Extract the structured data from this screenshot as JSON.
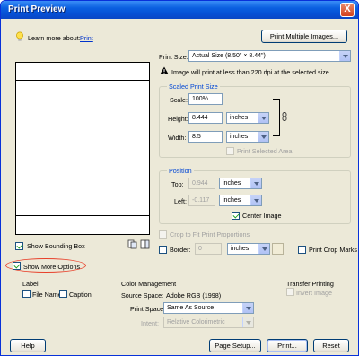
{
  "window": {
    "title": "Print Preview",
    "close_label": "X"
  },
  "learn": {
    "text": "Learn more about:",
    "link": "Print"
  },
  "buttons": {
    "print_multiple": "Print Multiple Images...",
    "help": "Help",
    "page_setup": "Page Setup...",
    "print": "Print...",
    "reset": "Reset"
  },
  "print_size": {
    "label": "Print Size:",
    "value": "Actual Size (8.50\" × 8.44\")"
  },
  "warning": "Image will print at less than 220 dpi at the selected size",
  "scaled": {
    "title": "Scaled Print Size",
    "scale_label": "Scale:",
    "scale_value": "100%",
    "height_label": "Height:",
    "height_value": "8.444",
    "height_unit": "inches",
    "width_label": "Width:",
    "width_value": "8.5",
    "width_unit": "inches",
    "print_selected": "Print Selected Area"
  },
  "position": {
    "title": "Position",
    "top_label": "Top:",
    "top_value": "0.944",
    "top_unit": "inches",
    "left_label": "Left:",
    "left_value": "-0.117",
    "left_unit": "inches",
    "center_image": "Center Image"
  },
  "crop_fit": "Crop to Fit Print Proportions",
  "border": {
    "label": "Border:",
    "value": "0",
    "unit": "inches"
  },
  "print_crop_marks": "Print Crop Marks",
  "show_bounding_box": "Show Bounding Box",
  "show_more_options": "Show More Options",
  "label_section": {
    "title": "Label",
    "file_name": "File Name",
    "caption": "Caption"
  },
  "color": {
    "title": "Color Management",
    "source_label": "Source Space:",
    "source_value": "Adobe RGB (1998)",
    "print_space_label": "Print Space:",
    "print_space_value": "Same As Source",
    "intent_label": "Intent:",
    "intent_value": "Relative Colorimetric"
  },
  "transfer": {
    "title": "Transfer Printing",
    "invert": "Invert Image"
  }
}
